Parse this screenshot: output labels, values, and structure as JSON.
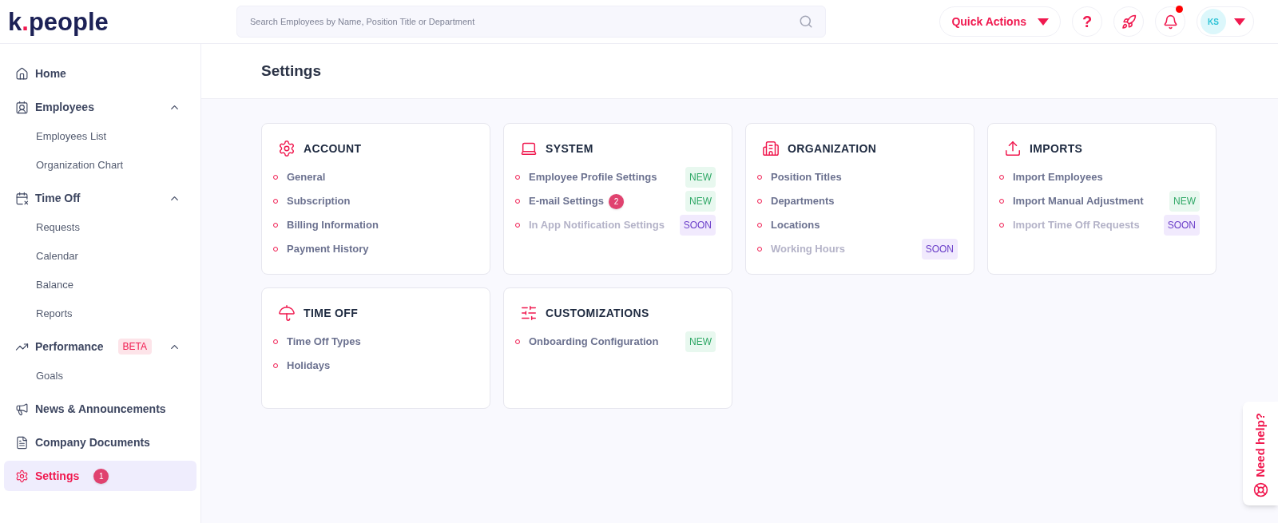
{
  "logo": {
    "before": "k",
    "dot": ".",
    "after": "people"
  },
  "search": {
    "placeholder": "Search Employees by Name, Position Title or Department"
  },
  "header": {
    "quick_actions": "Quick Actions",
    "help": "?",
    "notifications_unread": true,
    "avatar": "KS"
  },
  "sidebar": {
    "items": [
      {
        "label": "Home",
        "selected": false
      },
      {
        "label": "Employees",
        "selected": false,
        "expanded": true,
        "children": [
          {
            "label": "Employees List",
            "selected": false
          },
          {
            "label": "Organization Chart",
            "selected": false
          }
        ]
      },
      {
        "label": "Time Off",
        "selected": false,
        "expanded": true,
        "children": [
          {
            "label": "Requests",
            "selected": false
          },
          {
            "label": "Calendar",
            "selected": false
          },
          {
            "label": "Balance",
            "selected": false
          },
          {
            "label": "Reports",
            "selected": false
          }
        ]
      },
      {
        "label": "Performance",
        "selected": false,
        "tag": "BETA",
        "expanded": true,
        "children": [
          {
            "label": "Goals",
            "selected": false
          }
        ]
      },
      {
        "label": "News & Announcements",
        "selected": false
      },
      {
        "label": "Company Documents",
        "selected": false
      },
      {
        "label": "Settings",
        "selected": true,
        "count": "1"
      }
    ]
  },
  "page": {
    "title": "Settings"
  },
  "cards": [
    {
      "title": "ACCOUNT",
      "items": [
        {
          "label": "General",
          "disabled": false
        },
        {
          "label": "Subscription",
          "disabled": false
        },
        {
          "label": "Billing Information",
          "disabled": false
        },
        {
          "label": "Payment History",
          "disabled": false
        }
      ]
    },
    {
      "title": "SYSTEM",
      "items": [
        {
          "label": "Employee Profile Settings",
          "disabled": false,
          "tag": {
            "kind": "new",
            "text": "NEW"
          }
        },
        {
          "label": "E-mail Settings",
          "disabled": false,
          "count": "2",
          "tag": {
            "kind": "new",
            "text": "NEW"
          }
        },
        {
          "label": "In App Notification Settings",
          "disabled": true,
          "tag": {
            "kind": "soon",
            "text": "SOON"
          }
        }
      ]
    },
    {
      "title": "ORGANIZATION",
      "items": [
        {
          "label": "Position Titles",
          "disabled": false
        },
        {
          "label": "Departments",
          "disabled": false
        },
        {
          "label": "Locations",
          "disabled": false
        },
        {
          "label": "Working Hours",
          "disabled": true,
          "tag": {
            "kind": "soon",
            "text": "SOON"
          }
        }
      ]
    },
    {
      "title": "IMPORTS",
      "items": [
        {
          "label": "Import Employees",
          "disabled": false
        },
        {
          "label": "Import Manual Adjustment",
          "disabled": false,
          "tag": {
            "kind": "new",
            "text": "NEW"
          }
        },
        {
          "label": "Import Time Off Requests",
          "disabled": true,
          "tag": {
            "kind": "soon",
            "text": "SOON"
          }
        }
      ]
    },
    {
      "title": "TIME OFF",
      "items": [
        {
          "label": "Time Off Types",
          "disabled": false
        },
        {
          "label": "Holidays",
          "disabled": false
        }
      ]
    },
    {
      "title": "CUSTOMIZATIONS",
      "items": [
        {
          "label": "Onboarding Configuration",
          "disabled": false,
          "tag": {
            "kind": "new",
            "text": "NEW"
          }
        }
      ]
    }
  ],
  "help_tab": {
    "label": "Need help?"
  }
}
